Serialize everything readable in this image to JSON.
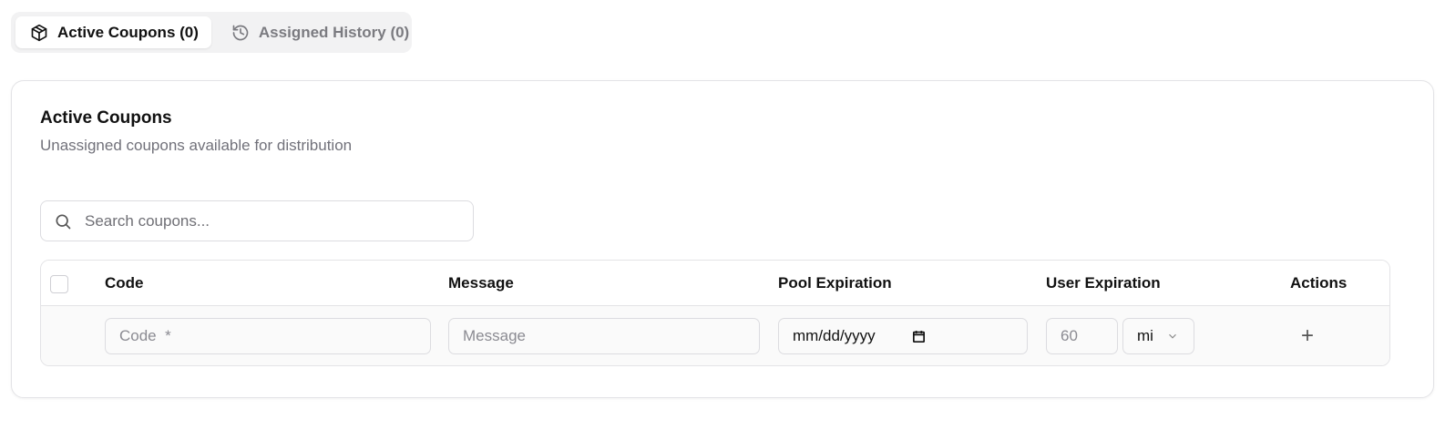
{
  "tabs": [
    {
      "label": "Active Coupons (0)",
      "icon": "package-icon",
      "active": true
    },
    {
      "label": "Assigned History (0)",
      "icon": "history-icon",
      "active": false
    }
  ],
  "card": {
    "title": "Active Coupons",
    "subtitle": "Unassigned coupons available for distribution"
  },
  "search": {
    "placeholder": "Search coupons..."
  },
  "table": {
    "columns": [
      "Code",
      "Message",
      "Pool Expiration",
      "User Expiration",
      "Actions"
    ],
    "new_row": {
      "code_placeholder": "Code  *",
      "message_placeholder": "Message",
      "pool_expiration": "mm/dd/yyyy",
      "user_expiration_placeholder": "60",
      "unit": "mi",
      "add_label": "+"
    }
  },
  "colors": {
    "accent": "#111111",
    "muted": "#71717a",
    "border": "#e3e3e6"
  }
}
